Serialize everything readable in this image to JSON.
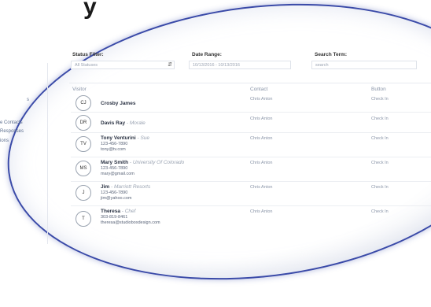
{
  "top_word": "y",
  "sidebar": {
    "items": [
      {
        "label": "s"
      },
      {
        "label": "e Contacts"
      },
      {
        "label": "Responses"
      },
      {
        "label": "ions"
      }
    ]
  },
  "filters": {
    "status_label": "Status Filter:",
    "status_value": "All Statuses",
    "date_label": "Date Range:",
    "date_value": "10/13/2016 - 10/13/2016",
    "search_label": "Search Term:",
    "search_placeholder": "search"
  },
  "table": {
    "columns": {
      "visitor": "Visitor",
      "contact": "Contact",
      "button": "Button"
    },
    "rows": [
      {
        "initials": "CJ",
        "name": "Crosby James",
        "sub": "",
        "lines": [],
        "contact": "Chris Anton",
        "button": "Check In"
      },
      {
        "initials": "DR",
        "name": "Davis Ray",
        "sub": "Morale",
        "lines": [],
        "contact": "Chris Anton",
        "button": "Check In"
      },
      {
        "initials": "TV",
        "name": "Tony Venturini",
        "sub": "Sue",
        "lines": [
          "123-456-7890",
          "tony@tv.com"
        ],
        "contact": "Chris Anton",
        "button": "Check In"
      },
      {
        "initials": "MS",
        "name": "Mary Smith",
        "sub": "University Of Colorado",
        "lines": [
          "123-456-7890",
          "mary@gmail.com"
        ],
        "contact": "Chris Anton",
        "button": "Check In"
      },
      {
        "initials": "J",
        "name": "Jim",
        "sub": "Marriott Resorts",
        "lines": [
          "123-456-7890",
          "jim@yahoo.com"
        ],
        "contact": "Chris Anton",
        "button": "Check In"
      },
      {
        "initials": "T",
        "name": "Theresa",
        "sub": "Chef",
        "lines": [
          "303-819-8461",
          "theresa@studioboxdesign.com"
        ],
        "contact": "Chris Anton",
        "button": "Check In"
      }
    ]
  }
}
